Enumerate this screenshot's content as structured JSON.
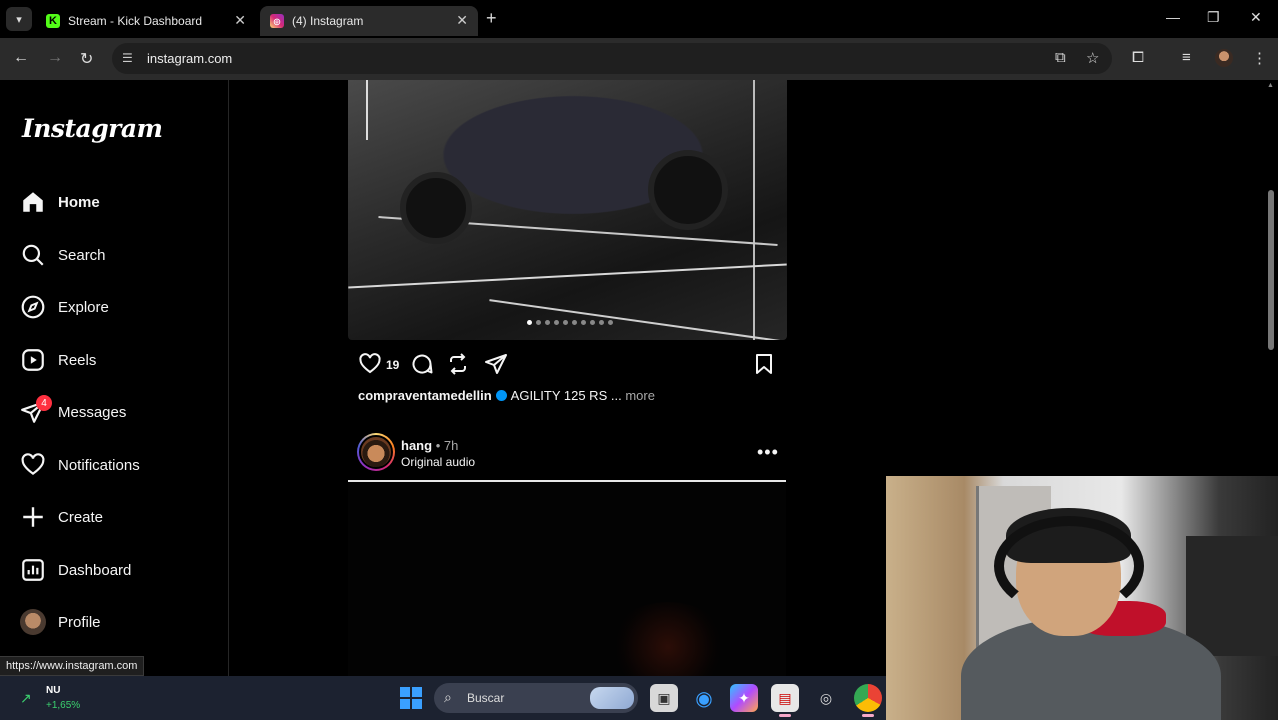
{
  "browser": {
    "tabs": [
      {
        "title": "Stream - Kick Dashboard",
        "favicon": "kick-icon",
        "active": false
      },
      {
        "title": "(4) Instagram",
        "favicon": "instagram-icon",
        "active": true
      }
    ],
    "url": "instagram.com",
    "status_url": "https://www.instagram.com"
  },
  "sidebar": {
    "logo": "Instagram",
    "items": [
      {
        "label": "Home",
        "icon": "home-icon"
      },
      {
        "label": "Search",
        "icon": "search-icon"
      },
      {
        "label": "Explore",
        "icon": "compass-icon"
      },
      {
        "label": "Reels",
        "icon": "reels-icon"
      },
      {
        "label": "Messages",
        "icon": "messages-icon",
        "badge": "4"
      },
      {
        "label": "Notifications",
        "icon": "heart-icon"
      },
      {
        "label": "Create",
        "icon": "plus-icon"
      },
      {
        "label": "Dashboard",
        "icon": "dashboard-icon"
      },
      {
        "label": "Profile",
        "icon": "avatar"
      }
    ]
  },
  "feed": {
    "post1": {
      "likes": "19",
      "username": "compraventamedellin",
      "caption": "AGILITY 125 RS ...",
      "more": "more",
      "carousel_count": 10,
      "carousel_index": 1
    },
    "post2": {
      "username": "hang",
      "time": "7h",
      "separator": "•",
      "audio": "Original audio"
    }
  },
  "taskbar": {
    "stock_ticker": "NU",
    "stock_change": "+1,65%",
    "search_placeholder": "Buscar"
  },
  "colors": {
    "badge": "#ff3040",
    "verified": "#0095f6",
    "stock_up": "#3bd16f"
  }
}
